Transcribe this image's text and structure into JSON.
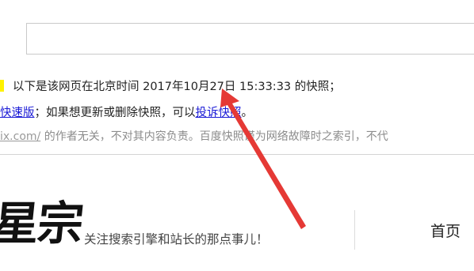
{
  "snapshot_header": {
    "line1": {
      "prefix": "以下是该网页在北京时间",
      "datetime": "2017年10月27日 15:33:33",
      "suffix": "的快照；"
    },
    "line2": {
      "link_fast": "快速版",
      "middle": "；如果想更新或删除快照，可以",
      "link_complain": "投诉快照",
      "end": "。"
    },
    "line3": {
      "url_fragment": "ix.com/",
      "text": "的作者无关，不对其内容负责。百度快照谨为网络故障时之索引，不代"
    }
  },
  "site": {
    "logo_text": "星宗",
    "tagline": "关注搜索引擎和站长的那点事儿！",
    "nav": {
      "home": "首页"
    }
  },
  "colors": {
    "annotation_arrow": "#e53935",
    "link_blue": "#1a1ad6",
    "highlight_yellow": "#fff200"
  }
}
